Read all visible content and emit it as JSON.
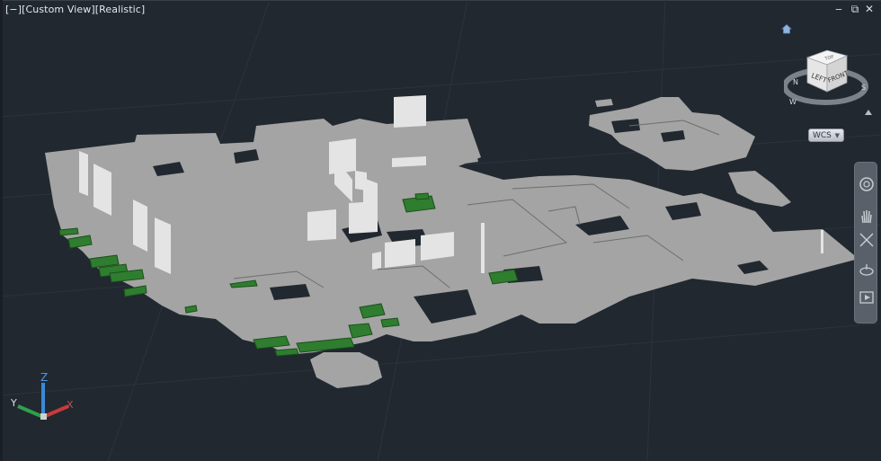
{
  "viewport": {
    "label": "[−][Custom View][Realistic]",
    "window_controls": {
      "minimize": "‒",
      "restore": "⧉",
      "close": "✕"
    }
  },
  "viewcube": {
    "top_label": "TOP",
    "left_face": "LEFT",
    "front_face": "FRONT",
    "compass": {
      "north": "N",
      "south": "S",
      "west": "W"
    },
    "home_icon": "home-icon"
  },
  "wcs_menu": {
    "label": "WCS"
  },
  "navigation_bar": {
    "tools": [
      "steering-wheel-icon",
      "pan-hand-icon",
      "zoom-extents-icon",
      "orbit-icon",
      "showmotion-icon"
    ]
  },
  "ucs_icon": {
    "x_label": "X",
    "y_label": "Y",
    "z_label": "Z"
  },
  "colors": {
    "background": "#212830",
    "floor_plan": "#a4a4a4",
    "walls": "#e4e4e4",
    "furniture": "#2f7d2f"
  }
}
